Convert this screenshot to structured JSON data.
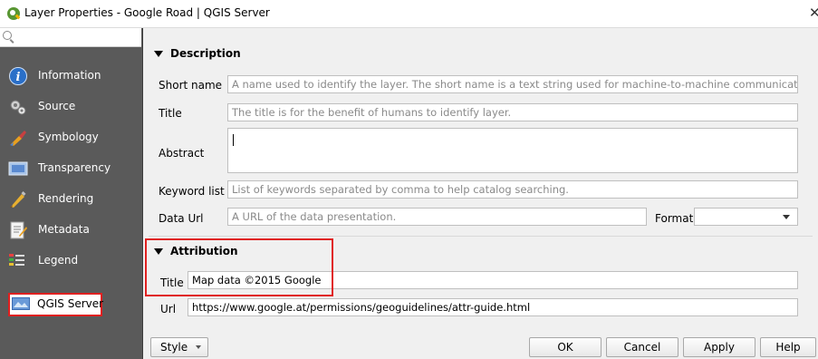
{
  "window": {
    "title": "Layer Properties - Google Road | QGIS Server",
    "close_glyph": "✕"
  },
  "sidebar": {
    "items": [
      {
        "label": "Information",
        "icon": "information-icon"
      },
      {
        "label": "Source",
        "icon": "source-icon"
      },
      {
        "label": "Symbology",
        "icon": "symbology-icon"
      },
      {
        "label": "Transparency",
        "icon": "transparency-icon"
      },
      {
        "label": "Rendering",
        "icon": "rendering-icon"
      },
      {
        "label": "Metadata",
        "icon": "metadata-icon"
      },
      {
        "label": "Legend",
        "icon": "legend-icon"
      },
      {
        "label": "QGIS Server",
        "icon": "qgis-server-icon",
        "selected": true
      }
    ]
  },
  "description": {
    "header": "Description",
    "short_name_label": "Short name",
    "short_name_placeholder": "A name used to identify the layer. The short name is a text string used for machine-to-machine communicat...",
    "title_label": "Title",
    "title_placeholder": "The title is for the benefit of humans to identify layer.",
    "abstract_label": "Abstract",
    "abstract_value": "",
    "keyword_label": "Keyword list",
    "keyword_placeholder": "List of keywords separated by comma to help catalog searching.",
    "dataurl_label": "Data Url",
    "dataurl_placeholder": "A URL of the data presentation.",
    "format_label": "Format",
    "format_value": ""
  },
  "attribution": {
    "header": "Attribution",
    "title_label": "Title",
    "title_value": "Map data ©2015 Google",
    "url_label": "Url",
    "url_value": "https://www.google.at/permissions/geoguidelines/attr-guide.html"
  },
  "buttons": {
    "style": "Style",
    "ok": "OK",
    "cancel": "Cancel",
    "apply": "Apply",
    "help": "Help"
  },
  "colors": {
    "sidebar_bg": "#5a5a5a",
    "highlight": "#e02020",
    "qgis_green": "#589632"
  }
}
